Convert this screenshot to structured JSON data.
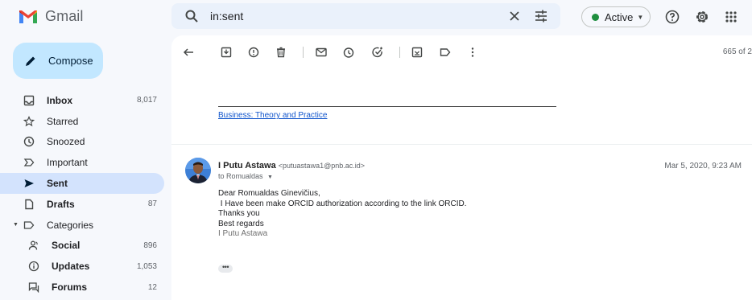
{
  "app": {
    "name": "Gmail"
  },
  "search": {
    "query": "in:sent"
  },
  "status": {
    "label": "Active"
  },
  "compose": {
    "label": "Compose"
  },
  "nav": {
    "items": [
      {
        "label": "Inbox",
        "count": "8,017",
        "bold": true,
        "icon": "inbox-icon"
      },
      {
        "label": "Starred",
        "count": "",
        "bold": false,
        "icon": "star-icon"
      },
      {
        "label": "Snoozed",
        "count": "",
        "bold": false,
        "icon": "snooze-icon"
      },
      {
        "label": "Important",
        "count": "",
        "bold": false,
        "icon": "important-icon"
      },
      {
        "label": "Sent",
        "count": "",
        "bold": true,
        "icon": "send-icon",
        "active": true
      },
      {
        "label": "Drafts",
        "count": "87",
        "bold": true,
        "icon": "draft-icon"
      },
      {
        "label": "Categories",
        "count": "",
        "bold": false,
        "icon": "label-icon"
      },
      {
        "label": "Social",
        "count": "896",
        "bold": true,
        "icon": "social-icon"
      },
      {
        "label": "Updates",
        "count": "1,053",
        "bold": true,
        "icon": "info-icon"
      },
      {
        "label": "Forums",
        "count": "12",
        "bold": true,
        "icon": "forum-icon"
      }
    ]
  },
  "toolbar": {
    "count": "665 of 2"
  },
  "thread": {
    "quoted_link": "Business: Theory and Practice",
    "message": {
      "sender_name": "I Putu Astawa",
      "sender_email": "<putuastawa1@pnb.ac.id>",
      "date": "Mar 5, 2020, 9:23 AM",
      "to": "to Romualdas",
      "body": [
        "Dear Romualdas Ginevičius,",
        " I Have been make ORCID authorization according to the link ORCID.",
        "Thanks you",
        "Best regards"
      ],
      "signature": "I Putu Astawa",
      "ellipsis": "•••"
    }
  },
  "colors": {
    "accent": "#c2e7ff",
    "active_nav": "#d3e3fd",
    "status": "#1e8e3e",
    "link": "#1155cc"
  }
}
